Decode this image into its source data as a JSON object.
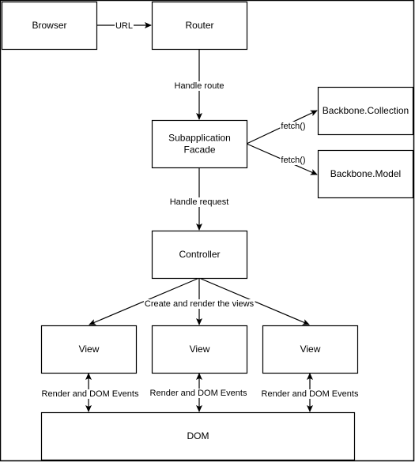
{
  "diagram": {
    "colors": {
      "stroke": "#000000",
      "fill": "#ffffff",
      "text": "#000000"
    },
    "nodes": [
      {
        "id": "browser",
        "label": [
          "Browser"
        ]
      },
      {
        "id": "router",
        "label": [
          "Router"
        ]
      },
      {
        "id": "subapp",
        "label": [
          "Subapplication",
          "Facade"
        ]
      },
      {
        "id": "collection",
        "label": [
          "Backbone.Collection"
        ]
      },
      {
        "id": "model",
        "label": [
          "Backbone.Model"
        ]
      },
      {
        "id": "controller",
        "label": [
          "Controller"
        ]
      },
      {
        "id": "view1",
        "label": [
          "View"
        ]
      },
      {
        "id": "view2",
        "label": [
          "View"
        ]
      },
      {
        "id": "view3",
        "label": [
          "View"
        ]
      },
      {
        "id": "dom",
        "label": [
          "DOM"
        ]
      }
    ],
    "edges": [
      {
        "id": "browser-router",
        "from": "browser",
        "to": "router",
        "label": "URL",
        "direction": "forward"
      },
      {
        "id": "router-subapp",
        "from": "router",
        "to": "subapp",
        "label": "Handle route",
        "direction": "forward"
      },
      {
        "id": "subapp-collection",
        "from": "subapp",
        "to": "collection",
        "label": "fetch()",
        "direction": "forward"
      },
      {
        "id": "subapp-model",
        "from": "subapp",
        "to": "model",
        "label": "fetch()",
        "direction": "forward"
      },
      {
        "id": "subapp-controller",
        "from": "subapp",
        "to": "controller",
        "label": "Handle request",
        "direction": "forward"
      },
      {
        "id": "controller-view1",
        "from": "controller",
        "to": "view1",
        "label": "",
        "direction": "forward"
      },
      {
        "id": "controller-view2",
        "from": "controller",
        "to": "view2",
        "label": "Create and render the views",
        "direction": "forward"
      },
      {
        "id": "controller-view3",
        "from": "controller",
        "to": "view3",
        "label": "",
        "direction": "forward"
      },
      {
        "id": "view1-dom",
        "from": "view1",
        "to": "dom",
        "label": "Render and DOM Events",
        "direction": "both"
      },
      {
        "id": "view2-dom",
        "from": "view2",
        "to": "dom",
        "label": "Render and DOM Events",
        "direction": "both"
      },
      {
        "id": "view3-dom",
        "from": "view3",
        "to": "dom",
        "label": "Render and DOM Events",
        "direction": "both"
      }
    ]
  }
}
